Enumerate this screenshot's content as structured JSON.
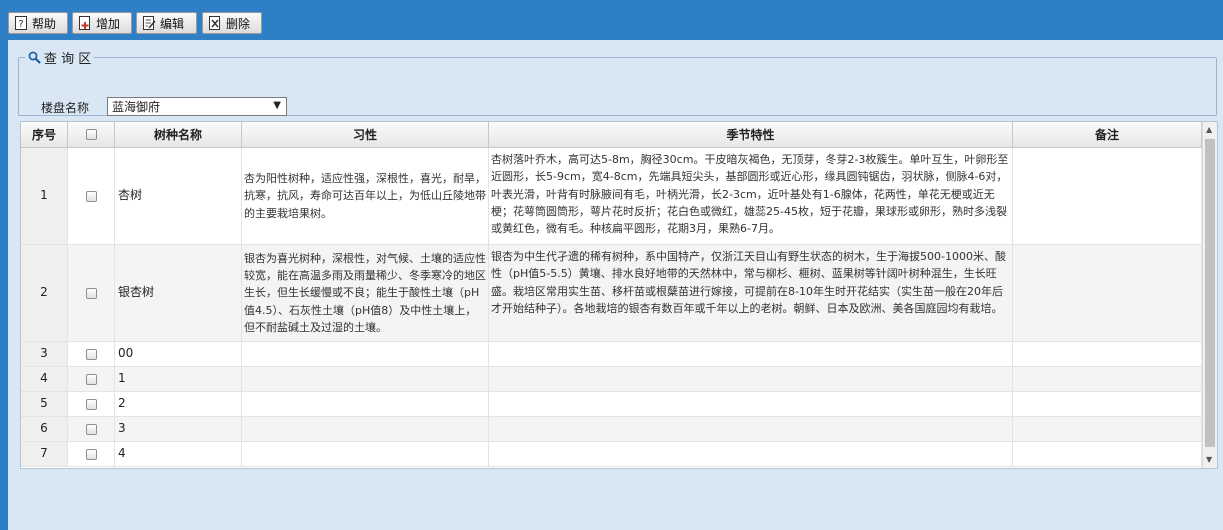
{
  "toolbar": {
    "help_label": "帮助",
    "add_label": "增加",
    "edit_label": "编辑",
    "delete_label": "删除"
  },
  "query": {
    "legend": "查 询 区",
    "label": "楼盘名称",
    "selected": "蓝海御府"
  },
  "grid": {
    "columns": [
      "序号",
      "",
      "树种名称",
      "习性",
      "季节特性",
      "备注"
    ],
    "rows": [
      {
        "no": "1",
        "name": "杏树",
        "habit": "杏为阳性树种，适应性强，深根性，喜光，耐旱，抗寒，抗风，寿命可达百年以上，为低山丘陵地带的主要栽培果树。",
        "season": "杏树落叶乔木，高可达5-8m，胸径30cm。干皮暗灰褐色，无顶芽，冬芽2-3枚簇生。单叶互生，叶卵形至近圆形，长5-9cm，宽4-8cm，先端具短尖头，基部圆形或近心形，缘具圆钝锯齿，羽状脉，侧脉4-6对，叶表光滑，叶背有时脉腋间有毛，叶柄光滑，长2-3cm，近叶基处有1-6腺体，花两性，单花无梗或近无梗；花萼筒圆筒形，萼片花时反折；花白色或微红，雄蕊25-45枚，短于花瓣，果球形或卵形，熟时多浅裂或黄红色，微有毛。种核扁平圆形，花期3月，果熟6-7月。",
        "note": ""
      },
      {
        "no": "2",
        "name": "银杏树",
        "habit": "银杏为喜光树种，深根性，对气候、土壤的适应性较宽，能在高温多雨及雨量稀少、冬季寒冷的地区生长，但生长缓慢或不良；能生于酸性土壤（pH值4.5）、石灰性土壤（pH值8）及中性土壤上，但不耐盐碱土及过湿的土壤。",
        "season": "银杏为中生代孑遗的稀有树种，系中国特产，仅浙江天目山有野生状态的树木，生于海拔500-1000米、酸性（pH值5-5.5）黄壤、排水良好地带的天然林中，常与柳杉、榧树、蓝果树等针阔叶树种混生，生长旺盛。栽培区常用实生苗、移杆苗或根蘖苗进行嫁接，可提前在8-10年生时开花结实（实生苗一般在20年后才开始结种子）。各地栽培的银杏有数百年或千年以上的老树。朝鲜、日本及欧洲、美各国庭园均有栽培。",
        "note": ""
      },
      {
        "no": "3",
        "name": "00",
        "habit": "",
        "season": "",
        "note": ""
      },
      {
        "no": "4",
        "name": "1",
        "habit": "",
        "season": "",
        "note": ""
      },
      {
        "no": "5",
        "name": "2",
        "habit": "",
        "season": "",
        "note": ""
      },
      {
        "no": "6",
        "name": "3",
        "habit": "",
        "season": "",
        "note": ""
      },
      {
        "no": "7",
        "name": "4",
        "habit": "",
        "season": "",
        "note": ""
      }
    ]
  },
  "icons": {
    "help": "help-icon",
    "add": "add-icon",
    "edit": "edit-icon",
    "delete": "delete-icon",
    "search": "search-icon"
  },
  "colors": {
    "frame_blue": "#2e7fc6",
    "panel_bg": "#d9e6f3",
    "row_alt": "#f4f4f4"
  }
}
